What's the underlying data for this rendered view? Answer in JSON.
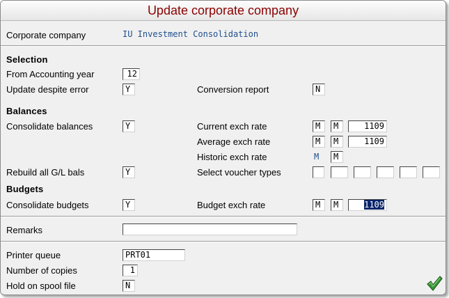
{
  "window": {
    "title": "Update corporate company"
  },
  "header": {
    "corporate_company_label": "Corporate company",
    "corporate_company_value": "IU Investment Consolidation"
  },
  "selection": {
    "heading": "Selection",
    "from_year_label": "From Accounting year",
    "from_year_value": "12",
    "update_despite_error_label": "Update despite error",
    "update_despite_error_value": "Y",
    "conversion_report_label": "Conversion report",
    "conversion_report_value": "N"
  },
  "balances": {
    "heading": "Balances",
    "consolidate_label": "Consolidate balances",
    "consolidate_value": "Y",
    "current_rate_label": "Current exch rate",
    "current_rate_type1": "M",
    "current_rate_type2": "M",
    "current_rate_value": "1109",
    "average_rate_label": "Average exch rate",
    "average_rate_type1": "M",
    "average_rate_type2": "M",
    "average_rate_value": "1109",
    "historic_rate_label": "Historic exch rate",
    "historic_rate_type1": "M",
    "historic_rate_type2": "M",
    "rebuild_label": "Rebuild all G/L bals",
    "rebuild_value": "Y",
    "voucher_types_label": "Select voucher types",
    "voucher_types_values": [
      "",
      "",
      "",
      "",
      "",
      ""
    ]
  },
  "budgets": {
    "heading": "Budgets",
    "consolidate_label": "Consolidate budgets",
    "consolidate_value": "Y",
    "budget_rate_label": "Budget exch rate",
    "budget_rate_type1": "M",
    "budget_rate_type2": "M",
    "budget_rate_value": "1109"
  },
  "remarks": {
    "label": "Remarks",
    "value": ""
  },
  "output": {
    "printer_queue_label": "Printer queue",
    "printer_queue_value": "PRT01",
    "copies_label": "Number of copies",
    "copies_value": "1",
    "hold_label": "Hold on spool file",
    "hold_value": "N"
  },
  "colors": {
    "title": "#8b0000",
    "value_blue": "#1f4e8c",
    "selection": "#0a246a",
    "ok_green": "#2e8b2e"
  },
  "icons": {
    "ok": "checkmark-icon"
  }
}
